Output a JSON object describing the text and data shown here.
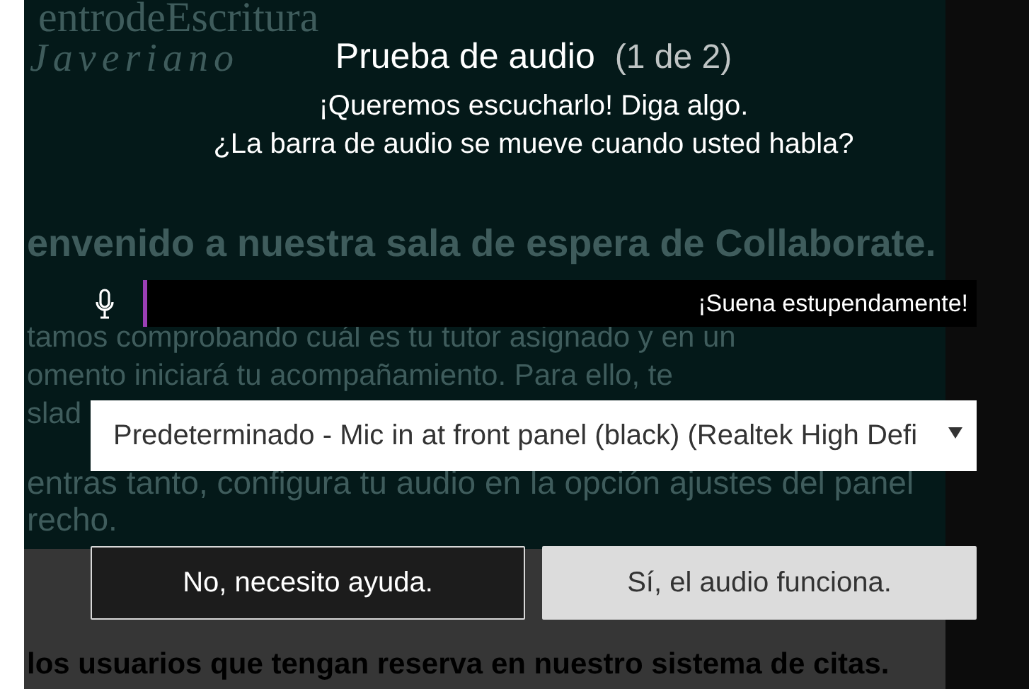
{
  "background": {
    "logo": "entrodeEscritura",
    "logo_subtitle": "Javeriano",
    "paragraphs": [
      {
        "bold": true,
        "lines": [
          "envenido a nuestra sala de espera de Collaborate."
        ]
      },
      {
        "bold": false,
        "lines": [
          "tamos comprobando cuál es tu tutor asignado y en un",
          "omento iniciará tu acompañamiento.  Para ello, te",
          "slad"
        ]
      },
      {
        "bold": false,
        "lines": [
          "entras tanto, configura tu audio en la opción ajustes del panel",
          "recho."
        ]
      },
      {
        "bold": true,
        "lines": [
          "los usuarios que tengan reserva en nuestro sistema de citas."
        ]
      }
    ]
  },
  "dialog": {
    "title": "Prueba de audio",
    "step": "(1 de 2)",
    "prompt_lines": [
      "¡Queremos escucharlo! Diga algo.",
      "¿La barra de audio se mueve cuando usted habla?"
    ],
    "meter": {
      "level": 0.005,
      "message": "¡Suena estupendamente!"
    },
    "device": {
      "value": "Predeterminado - Mic in at front panel (black) (Realtek High Defi"
    },
    "buttons": [
      {
        "label": "No, necesito ayuda.",
        "kind": "secondary"
      },
      {
        "label": "Sí, el audio funciona.",
        "kind": "primary"
      }
    ]
  }
}
